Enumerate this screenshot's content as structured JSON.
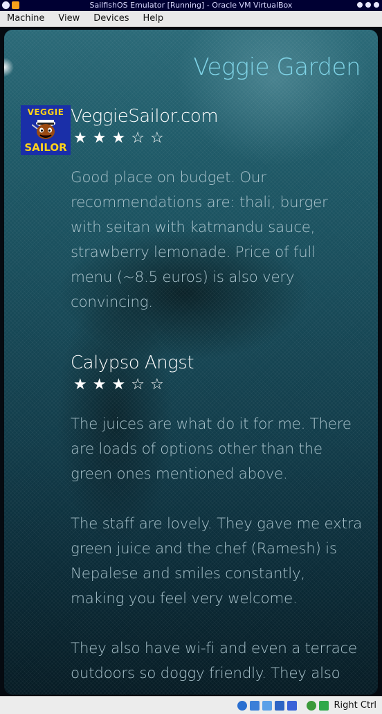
{
  "window": {
    "title": "SailfishOS Emulator [Running] - Oracle VM VirtualBox"
  },
  "menu": {
    "items": [
      "Machine",
      "View",
      "Devices",
      "Help"
    ]
  },
  "app": {
    "page_title": "Veggie Garden",
    "reviews": [
      {
        "reviewer": "VeggieSailor.com",
        "logo_text_top": "VEGGIE",
        "logo_text_bottom": "SAILOR",
        "rating": 3,
        "max_rating": 5,
        "text": "Good place on budget. Our\nrecommendations are: thali, burger\nwith seitan with katmandu sauce,\nstrawberry lemonade. Price of full\nmenu (~8.5 euros) is also very\nconvincing."
      },
      {
        "reviewer": "Calypso Angst",
        "rating": 3,
        "max_rating": 5,
        "text": "The juices are what do it for me. There\nare loads of options other than the\ngreen ones mentioned above.\n\nThe staff are lovely. They gave me extra\ngreen juice and the chef (Ramesh) is\nNepalese and smiles constantly,\nmaking you feel very welcome.\n\nThey also have wi-fi and even a terrace\noutdoors so doggy friendly. They also"
      }
    ]
  },
  "statusbar": {
    "host_key": "Right Ctrl",
    "icons": [
      "hard-disk-icon",
      "network-icon",
      "shared-folders-icon",
      "display-icon",
      "usb-icon",
      "mouse-integration-icon",
      "host-key-arrow-icon"
    ],
    "colors": {
      "star_filled": "#ffffff",
      "title": "#7fd3e6",
      "body_text": "#a9c3cc"
    }
  }
}
